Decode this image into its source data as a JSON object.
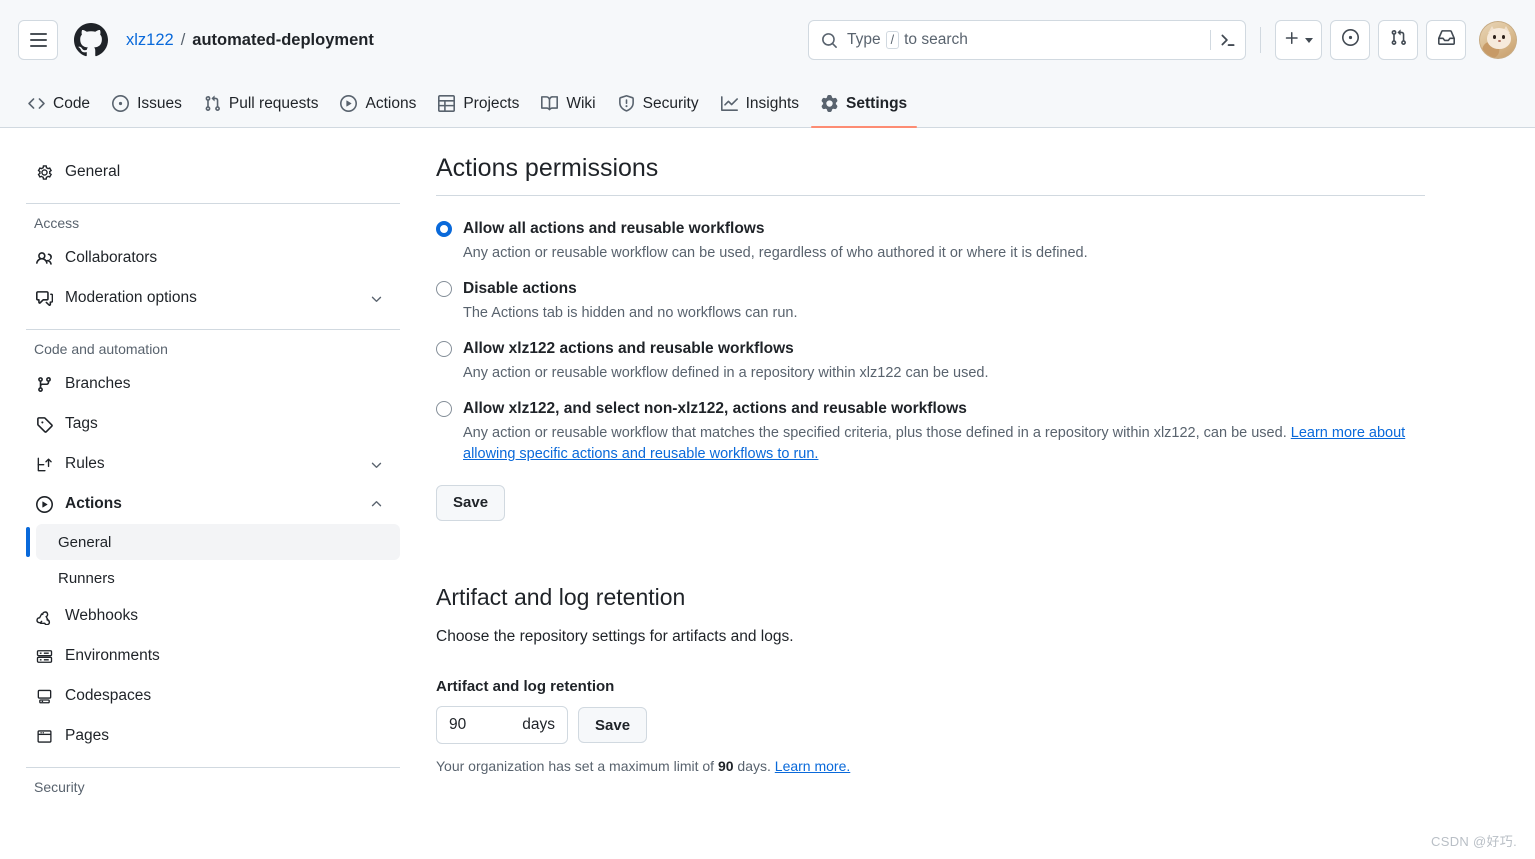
{
  "header": {
    "menu_icon": "hamburger-icon",
    "logo_icon": "github-logo-icon",
    "owner": "xlz122",
    "separator": "/",
    "repo": "automated-deployment",
    "search": {
      "placeholder_prefix": "Type",
      "slash_key": "/",
      "placeholder_suffix": "to search",
      "search_icon": "search-icon",
      "command_icon": "terminal-icon"
    },
    "actions": [
      {
        "name": "create-new-button",
        "icon": "plus-icon",
        "has_caret": true
      },
      {
        "name": "issues-button",
        "icon": "issue-opened-icon",
        "has_caret": false
      },
      {
        "name": "pull-requests-button",
        "icon": "git-pull-request-icon",
        "has_caret": false
      },
      {
        "name": "notifications-button",
        "icon": "inbox-icon",
        "has_caret": false
      }
    ],
    "avatar_name": "user-avatar"
  },
  "repo_nav": {
    "tabs": [
      {
        "label": "Code",
        "icon": "code-icon",
        "active": false
      },
      {
        "label": "Issues",
        "icon": "issue-opened-icon",
        "active": false
      },
      {
        "label": "Pull requests",
        "icon": "git-pull-request-icon",
        "active": false
      },
      {
        "label": "Actions",
        "icon": "play-icon",
        "active": false
      },
      {
        "label": "Projects",
        "icon": "table-icon",
        "active": false
      },
      {
        "label": "Wiki",
        "icon": "book-icon",
        "active": false
      },
      {
        "label": "Security",
        "icon": "shield-icon",
        "active": false
      },
      {
        "label": "Insights",
        "icon": "graph-icon",
        "active": false
      },
      {
        "label": "Settings",
        "icon": "gear-icon",
        "active": true
      }
    ],
    "active_underline_color": "#fd8c73"
  },
  "sidebar": {
    "general": {
      "label": "General",
      "icon": "gear-icon"
    },
    "groups": [
      {
        "title": "Access",
        "items": [
          {
            "label": "Collaborators",
            "icon": "people-icon",
            "chevron": ""
          },
          {
            "label": "Moderation options",
            "icon": "comment-discussion-icon",
            "chevron": "down"
          }
        ]
      },
      {
        "title": "Code and automation",
        "items": [
          {
            "label": "Branches",
            "icon": "git-branch-icon",
            "chevron": ""
          },
          {
            "label": "Tags",
            "icon": "tag-icon",
            "chevron": ""
          },
          {
            "label": "Rules",
            "icon": "rules-icon",
            "chevron": "down"
          },
          {
            "label": "Actions",
            "icon": "play-icon",
            "chevron": "up",
            "expanded": true,
            "children": [
              {
                "label": "General",
                "selected": true
              },
              {
                "label": "Runners",
                "selected": false
              }
            ]
          },
          {
            "label": "Webhooks",
            "icon": "webhook-icon",
            "chevron": ""
          },
          {
            "label": "Environments",
            "icon": "server-icon",
            "chevron": ""
          },
          {
            "label": "Codespaces",
            "icon": "codespaces-icon",
            "chevron": ""
          },
          {
            "label": "Pages",
            "icon": "browser-icon",
            "chevron": ""
          }
        ]
      },
      {
        "title": "Security",
        "items": []
      }
    ],
    "selected_indicator_color": "#0969da"
  },
  "main": {
    "permissions": {
      "title": "Actions permissions",
      "options": [
        {
          "label": "Allow all actions and reusable workflows",
          "description": "Any action or reusable workflow can be used, regardless of who authored it or where it is defined.",
          "checked": true
        },
        {
          "label": "Disable actions",
          "description": "The Actions tab is hidden and no workflows can run.",
          "checked": false
        },
        {
          "label": "Allow xlz122 actions and reusable workflows",
          "description": "Any action or reusable workflow defined in a repository within xlz122 can be used.",
          "checked": false
        },
        {
          "label": "Allow xlz122, and select non-xlz122, actions and reusable workflows",
          "description": "Any action or reusable workflow that matches the specified criteria, plus those defined in a repository within xlz122, can be used. ",
          "link_text": "Learn more about allowing specific actions and reusable workflows to run.",
          "checked": false
        }
      ],
      "save_label": "Save"
    },
    "retention": {
      "title": "Artifact and log retention",
      "description": "Choose the repository settings for artifacts and logs.",
      "field_label": "Artifact and log retention",
      "value": "90",
      "unit": "days",
      "save_label": "Save",
      "note_prefix": "Your organization has set a maximum limit of ",
      "note_value": "90",
      "note_suffix": " days. ",
      "note_link": "Learn more."
    }
  },
  "watermark": "CSDN @好巧."
}
